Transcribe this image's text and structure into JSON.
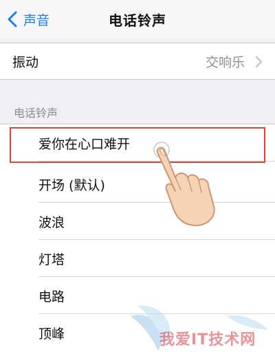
{
  "nav": {
    "back_label": "声音",
    "title": "电话铃声"
  },
  "vibration": {
    "label": "振动",
    "value": "交响乐"
  },
  "ringtones": {
    "section_header": "电话铃声",
    "items": [
      {
        "label": "爱你在心口难开",
        "selected": true
      },
      {
        "label": "开场 (默认)"
      },
      {
        "label": "波浪"
      },
      {
        "label": "灯塔"
      },
      {
        "label": "电路"
      },
      {
        "label": "顶峰"
      }
    ]
  },
  "watermark": {
    "text": "我爱IT技术网"
  },
  "colors": {
    "accent": "#1a7cf0",
    "highlight": "#d9453a",
    "background": "#efeff4"
  },
  "icons": {
    "back": "chevron-left-icon",
    "disclosure": "chevron-right-icon",
    "pointer": "pointing-hand-icon"
  }
}
